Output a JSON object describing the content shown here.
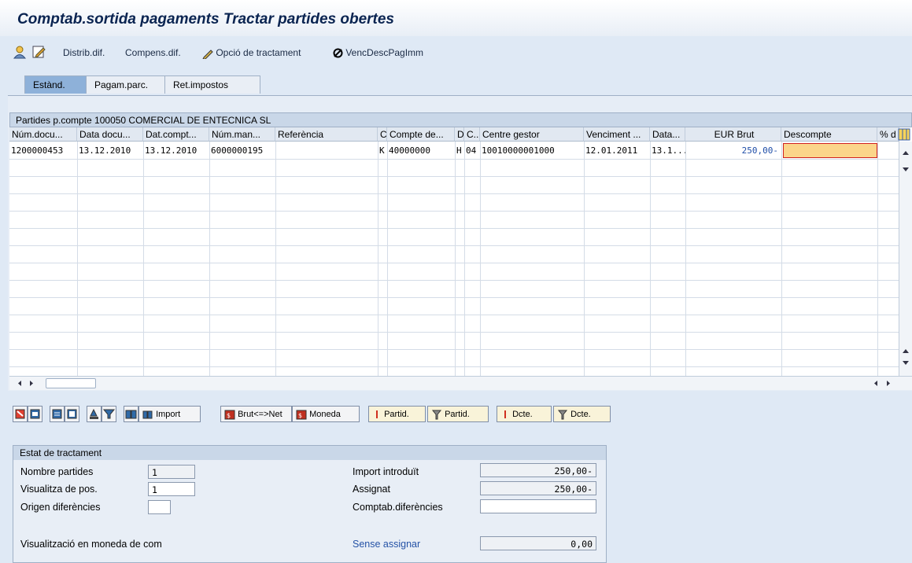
{
  "header": {
    "title": "Comptab.sortida pagaments Tractar partides obertes"
  },
  "toolbar": {
    "distrib": "Distrib.dif.",
    "compens": "Compens.dif.",
    "opcio": "Opció de tractament",
    "venc": "VencDescPagImm"
  },
  "tabs": [
    "Estànd.",
    "Pagam.parc.",
    "Ret.impostos"
  ],
  "grid": {
    "title": "Partides p.compte 100050 COMERCIAL DE ENTECNICA SL",
    "columns": [
      "Núm.docu...",
      "Data docu...",
      "Dat.compt...",
      "Núm.man...",
      "Referència",
      "C",
      "Compte de...",
      "D",
      "C...",
      "Centre gestor",
      "Venciment ...",
      "Data...",
      "EUR Brut",
      "Descompte",
      "% d"
    ],
    "rows": [
      [
        "1200000453",
        "13.12.2010",
        "13.12.2010",
        "6000000195",
        "",
        "K",
        "40000000",
        "H",
        "04",
        "10010000001000",
        "12.01.2011",
        "13.1...",
        "250,00-",
        ""
      ]
    ]
  },
  "buttons": {
    "import": "Import",
    "brutnet": "Brut<=>Net",
    "moneda": "Moneda",
    "partid1": "Partid.",
    "partid2": "Partid.",
    "dcte1": "Dcte.",
    "dcte2": "Dcte."
  },
  "status": {
    "title": "Estat de tractament",
    "nombre_label": "Nombre partides",
    "nombre_value": "1",
    "visual_label": "Visualitza de pos.",
    "visual_value": "1",
    "origen_label": "Origen diferències",
    "origen_value": "",
    "moneda_label": "Visualització en moneda de com",
    "import_label": "Import introduït",
    "import_value": "250,00-",
    "assignat_label": "Assignat",
    "assignat_value": "250,00-",
    "comptab_label": "Comptab.diferències",
    "comptab_value": "",
    "sense_label": "Sense assignar",
    "sense_value": "0,00"
  }
}
